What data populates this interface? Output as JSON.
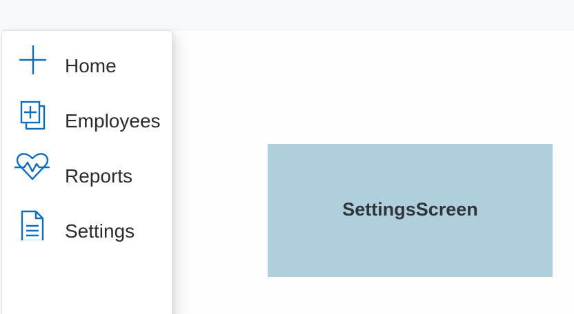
{
  "colors": {
    "accent": "#0f6cbd",
    "panel_bg": "#aecfdb",
    "text": "#2b2b2b"
  },
  "nav": {
    "items": [
      {
        "label": "Home",
        "icon": "add-icon"
      },
      {
        "label": "Employees",
        "icon": "copy-add-icon"
      },
      {
        "label": "Reports",
        "icon": "heart-pulse-icon"
      },
      {
        "label": "Settings",
        "icon": "document-icon"
      }
    ]
  },
  "main": {
    "panel_title": "SettingsScreen"
  }
}
